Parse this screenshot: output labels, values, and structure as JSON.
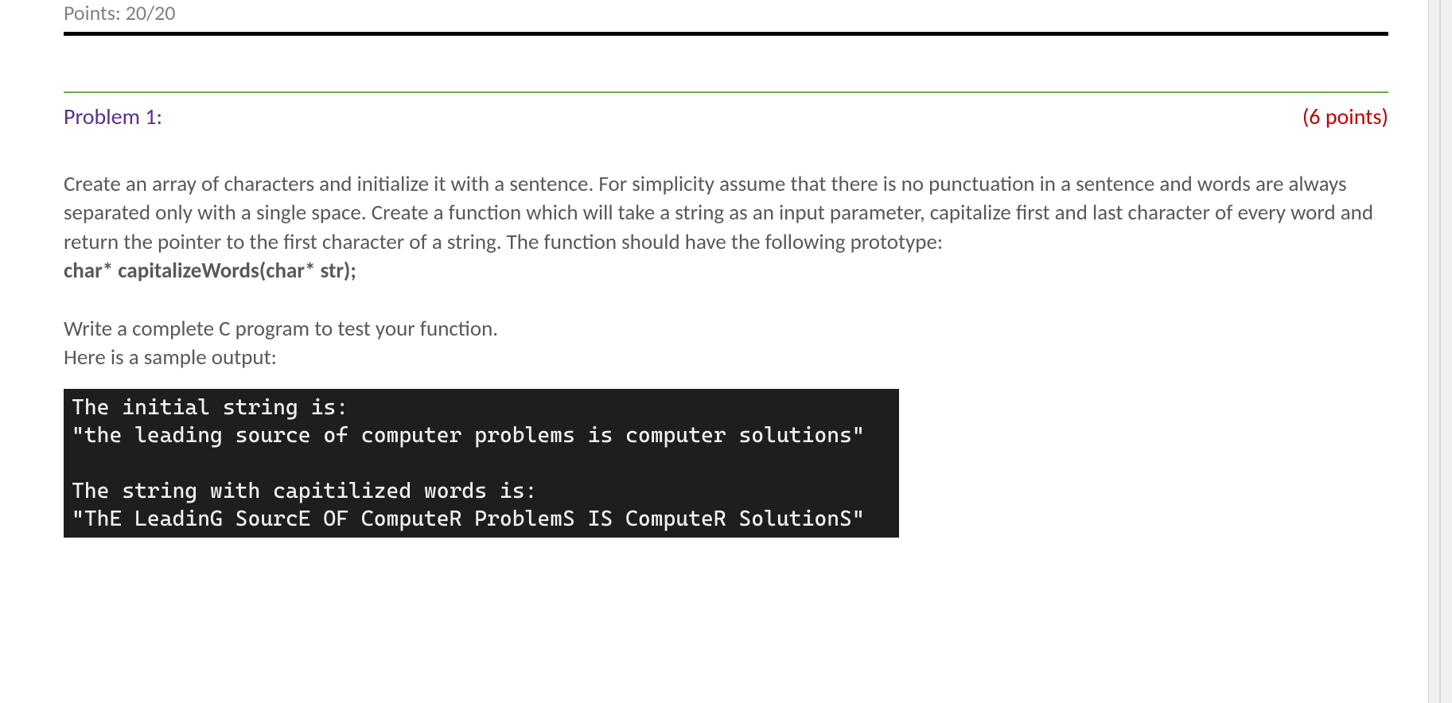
{
  "header": {
    "points": "Points: 20/20"
  },
  "problem": {
    "title": "Problem 1:",
    "points": "(6 points)",
    "description_p1": "Create an array of characters and initialize it with a sentence. For simplicity assume that there is no punctuation in a sentence and words are always separated only with a single space. Create a function which will take a string as an input parameter, capitalize first and last character of every word and return the pointer to the first character of a string. The function should have the following prototype:",
    "prototype": "char* capitalizeWords(char* str);",
    "description_p2": "Write a complete C program to test your function.",
    "description_p3": "Here is a sample output:",
    "terminal_output": "The initial string is:\n\"the leading source of computer problems is computer solutions\"\n\nThe string with capitilized words is:\n\"ThE LeadinG SourcE OF ComputeR ProblemS IS ComputeR SolutionS\""
  }
}
